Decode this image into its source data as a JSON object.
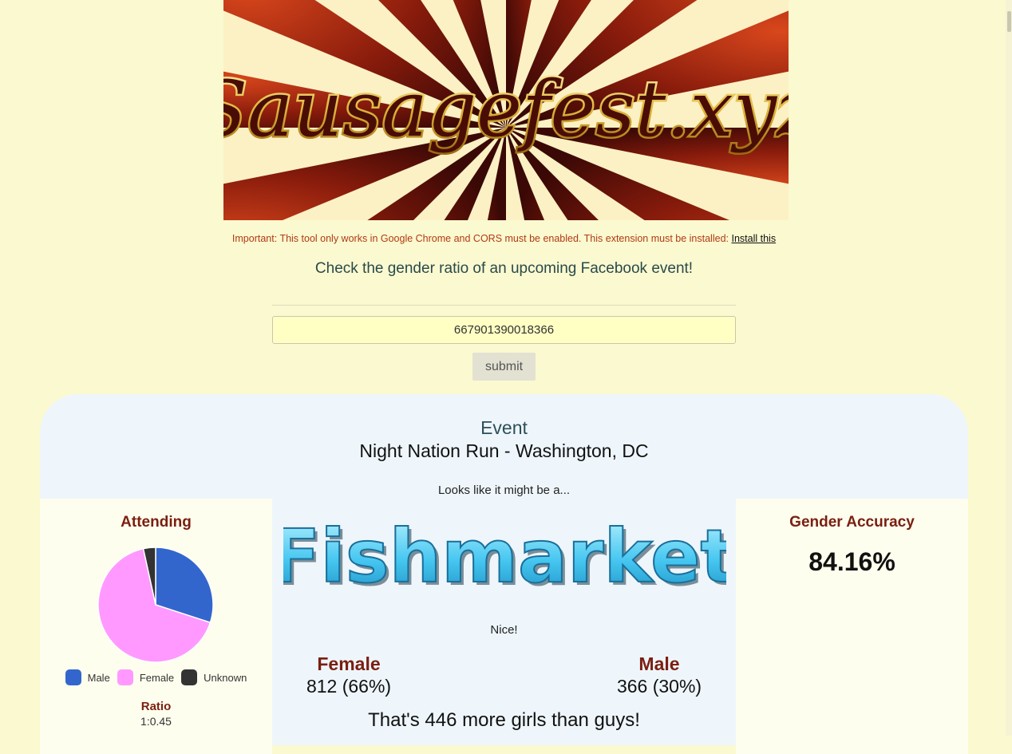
{
  "header": {
    "logo_text": "Sausagefest.xyz",
    "notice_text": "Important: This tool only works in Google Chrome and CORS must be enabled. This extension must be installed:",
    "notice_link": "Install this",
    "tagline": "Check the gender ratio of an upcoming Facebook event!"
  },
  "form": {
    "event_id_value": "667901390018366",
    "submit_label": "submit"
  },
  "event": {
    "heading": "Event",
    "name": "Night Nation Run - Washington, DC",
    "verdict_intro": "Looks like it might be a...",
    "verdict": "Fishmarket",
    "comment": "Nice!"
  },
  "attending": {
    "title": "Attending",
    "legend": [
      {
        "label": "Male",
        "color": "#3366cc"
      },
      {
        "label": "Female",
        "color": "#ff99ff"
      },
      {
        "label": "Unknown",
        "color": "#333333"
      }
    ],
    "ratio_label": "Ratio",
    "ratio_value": "1:0.45"
  },
  "chart_data": {
    "type": "pie",
    "slices": [
      {
        "label": "Male",
        "value": 366,
        "color": "#3366cc"
      },
      {
        "label": "Female",
        "value": 812,
        "color": "#ff99ff"
      },
      {
        "label": "Unknown",
        "value": 42,
        "color": "#333333"
      }
    ],
    "legend_position": "bottom"
  },
  "stats": {
    "female_label": "Female",
    "female_value": "812 (66%)",
    "male_label": "Male",
    "male_value": "366 (30%)",
    "summary": "That's 446 more girls than guys!"
  },
  "accuracy": {
    "title": "Gender Accuracy",
    "value": "84.16%"
  }
}
